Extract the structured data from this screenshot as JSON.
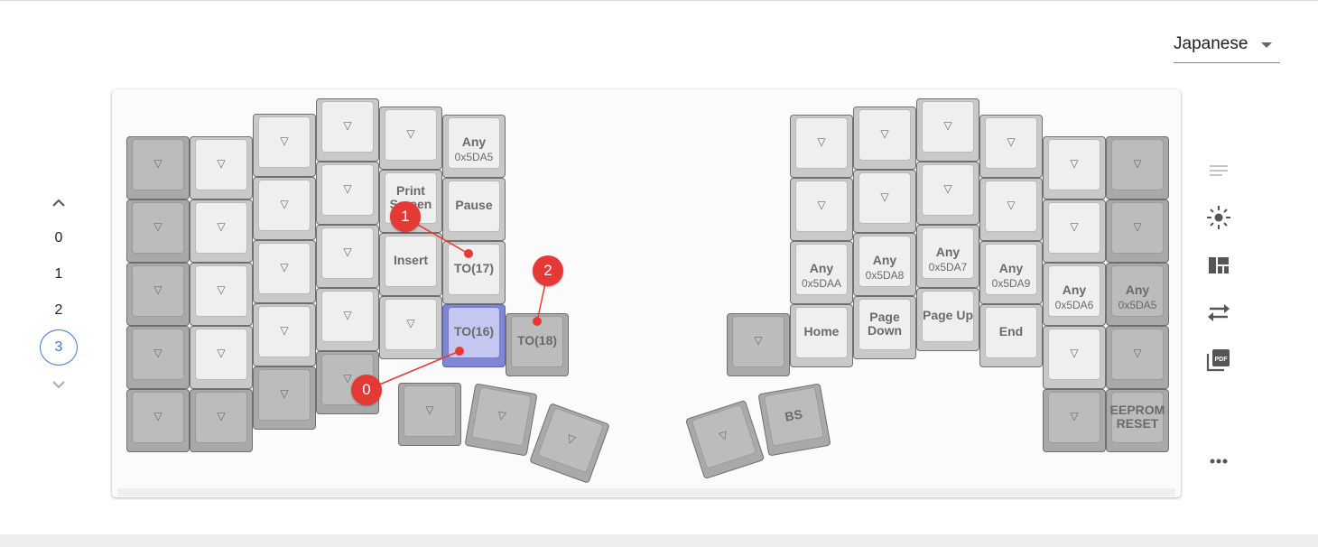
{
  "language_select": {
    "value": "Japanese"
  },
  "layers": {
    "up_icon": "chevron-up-icon",
    "down_icon": "chevron-down-icon",
    "items": [
      "0",
      "1",
      "2",
      "3"
    ],
    "active": "3"
  },
  "keys": {
    "triangle": "▽",
    "any": "Any",
    "print_screen_1": "Print",
    "print_screen_2": "Screen",
    "pause": "Pause",
    "insert": "Insert",
    "to17": "TO(17)",
    "to16": "TO(16)",
    "to18": "TO(18)",
    "home": "Home",
    "page_down_1": "Page",
    "page_down_2": "Down",
    "page_up": "Page Up",
    "end": "End",
    "bs": "BS",
    "eeprom_1": "EEPROM",
    "eeprom_2": "RESET",
    "hex_5DA5": "0x5DA5",
    "hex_5DAA": "0x5DAA",
    "hex_5DA8": "0x5DA8",
    "hex_5DA7": "0x5DA7",
    "hex_5DA9": "0x5DA9",
    "hex_5DA6": "0x5DA6"
  },
  "markers": [
    "0",
    "1",
    "2"
  ],
  "colors": {
    "accent": "#3f77c7",
    "marker": "#e53935",
    "selected_key": "#7f86d6"
  },
  "toolbar": {
    "icons": [
      "text-lines-icon",
      "lighting-icon",
      "layout-icon",
      "swap-icon",
      "pdf-icon",
      "more-icon"
    ]
  }
}
